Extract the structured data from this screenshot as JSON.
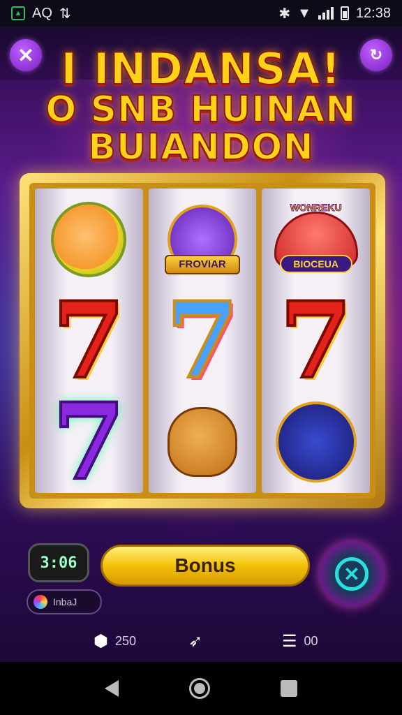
{
  "status_bar": {
    "left_text": "AQ",
    "time": "12:38"
  },
  "title": {
    "line1": "I INDANSA!",
    "line2a": "O SNB HUINAN",
    "line2b": "BUIANDON"
  },
  "reels": {
    "top_mid_banner": "FROVIAR",
    "top_right_top": "WONREKU",
    "top_right_bottom": "BIOCEUA"
  },
  "controls": {
    "timer": "3:06",
    "bonus_label": "Bonus",
    "user_label": "InbaJ"
  },
  "stats": {
    "left_value": "250",
    "right_value": "00"
  },
  "icons": {
    "close": "close-icon",
    "menu": "refresh-icon",
    "spin": "spin-icon"
  },
  "colors": {
    "accent_gold": "#ffd21a",
    "accent_purple": "#7a1fc0",
    "bonus_yellow": "#f3c20a"
  }
}
